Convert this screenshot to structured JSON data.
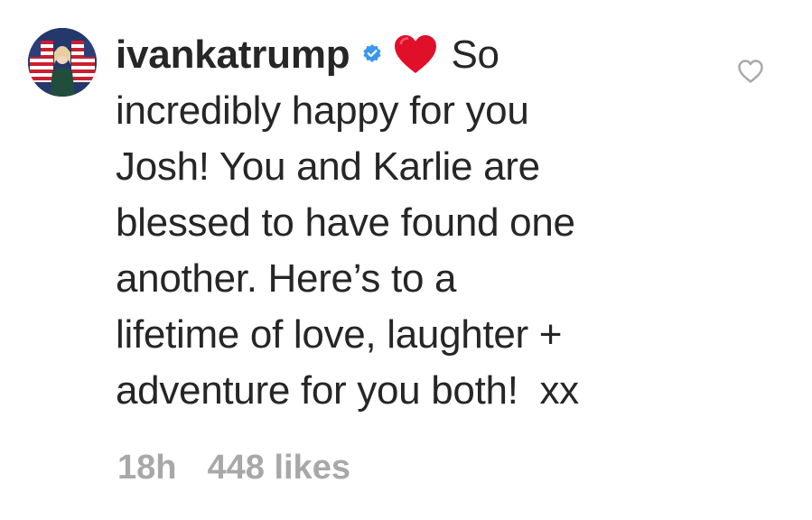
{
  "comment": {
    "username": "ivankatrump",
    "verified_icon": "verified-badge-icon",
    "emoji_icon": "red-heart-emoji-icon",
    "text_lines": [
      "So",
      "incredibly happy for you",
      "Josh! You and Karlie are",
      "blessed to have found one",
      "another. Here’s to a",
      "lifetime of love, laughter +",
      "adventure for you both!  xx"
    ],
    "timestamp": "18h",
    "likes": "448 likes",
    "like_icon": "heart-outline-icon"
  },
  "colors": {
    "text": "#262626",
    "meta": "#a8a8a8",
    "verified": "#3897f0",
    "heart": "#e0102a",
    "like_outline": "#a8a8a8"
  }
}
